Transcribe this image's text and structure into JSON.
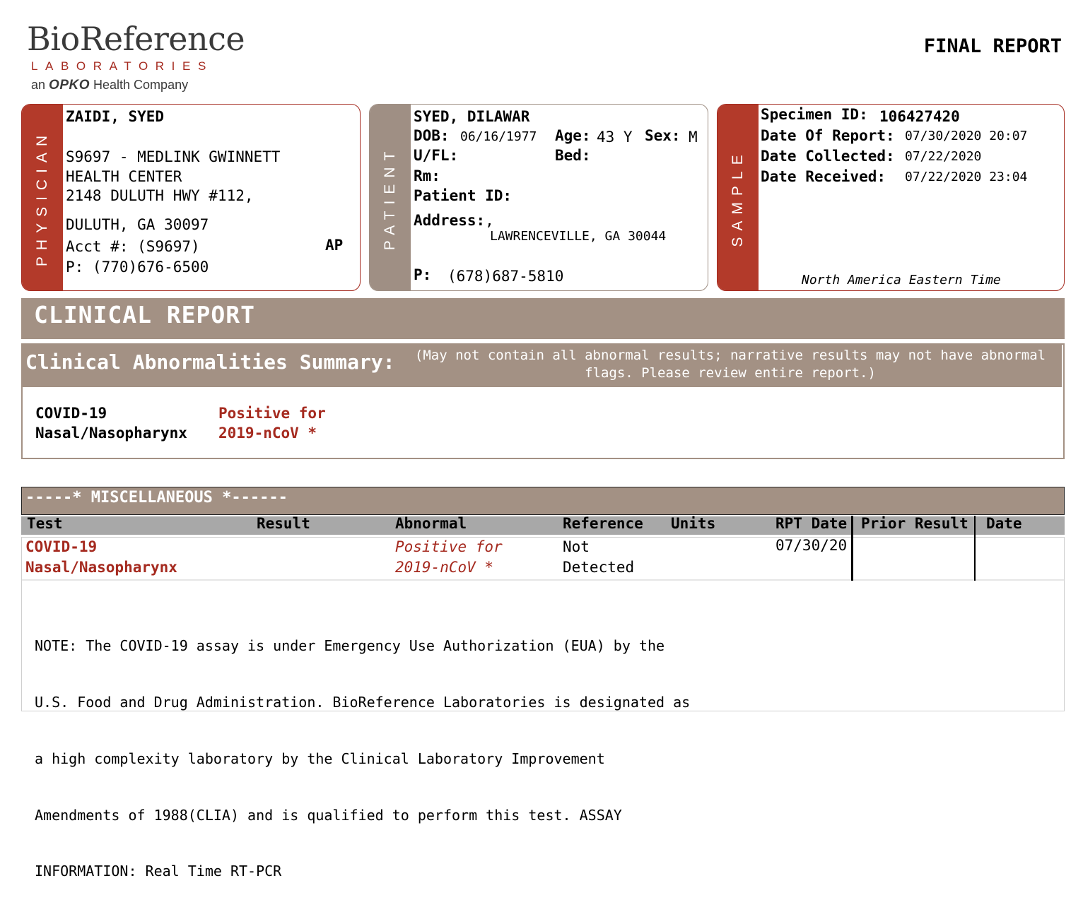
{
  "logo": {
    "name": "BioReference",
    "sub": "LABORATORIES",
    "company_prefix": "an",
    "company_brand": "OPKO",
    "company_suffix": "Health Company"
  },
  "header": {
    "title": "FINAL REPORT"
  },
  "physician": {
    "tab": "PHYSICIAN",
    "name": "ZAIDI, SYED",
    "practice_line1": "S9697 - MEDLINK GWINNETT",
    "practice_line2": "HEALTH CENTER",
    "address_line1": "2148 DULUTH HWY #112,",
    "city_line": "DULUTH, GA 30097",
    "acct": "Acct #: (S9697)",
    "ap": "AP",
    "phone": "P: (770)676-6500"
  },
  "patient": {
    "tab": "PATIENT",
    "name": "SYED, DILAWAR",
    "dob_label": "DOB:",
    "dob": "06/16/1977",
    "age_label": "Age:",
    "age": "43 Y",
    "sex_label": "Sex:",
    "sex": "M",
    "ufl_label": "U/FL:",
    "bed_label": "Bed:",
    "rm_label": "Rm:",
    "patient_id_label": "Patient ID:",
    "address_label": "Address:",
    "address_comma": ",",
    "address_city": "LAWRENCEVILLE, GA 30044",
    "phone_label": "P:",
    "phone": "(678)687-5810"
  },
  "sample": {
    "tab": "SAMPLE",
    "specimen_label": "Specimen ID:",
    "specimen_id": "106427420",
    "report_label": "Date Of Report:",
    "report_date": "07/30/2020 20:07",
    "collected_label": "Date Collected:",
    "collected_date": "07/22/2020",
    "received_label": "Date Received:",
    "received_date": "07/22/2020 23:04",
    "timezone": "North America Eastern Time"
  },
  "clinical_report": {
    "title": "CLINICAL REPORT"
  },
  "summary": {
    "title": "Clinical Abnormalities Summary:",
    "note_line1": "(May not contain all abnormal results; narrative results may not have abnormal",
    "note_line2": "flags. Please review entire report.)",
    "test_line1": "COVID-19",
    "test_line2": "Nasal/Nasopharynx",
    "result_line1": "Positive for",
    "result_line2": "2019-nCoV *"
  },
  "misc": {
    "title": "-----* MISCELLANEOUS *------",
    "columns": {
      "test": "Test",
      "result": "Result",
      "abnormal": "Abnormal",
      "reference": "Reference",
      "units": "Units",
      "rpt_date": "RPT Date",
      "prior_result": "Prior Result",
      "date": "Date"
    },
    "row": {
      "test_line1": "COVID-19",
      "test_line2": "Nasal/Nasopharynx",
      "abnormal_line1": "Positive for",
      "abnormal_line2": "2019-nCoV *",
      "reference_line1": "Not",
      "reference_line2": "Detected",
      "rpt_date": "07/30/20"
    },
    "note_lines": [
      "NOTE: The COVID-19 assay is under Emergency Use Authorization (EUA) by the",
      "U.S. Food and Drug Administration. BioReference Laboratories is designated as",
      "a high complexity laboratory by the Clinical Laboratory Improvement",
      "Amendments of 1988(CLIA) and is qualified to perform this test. ASSAY",
      "INFORMATION: Real Time RT-PCR"
    ]
  },
  "colors": {
    "brand_red": "#a52a1f",
    "tab_red": "#b33a2a",
    "header_taupe": "#a39184",
    "column_gray": "#a8a8a8"
  }
}
